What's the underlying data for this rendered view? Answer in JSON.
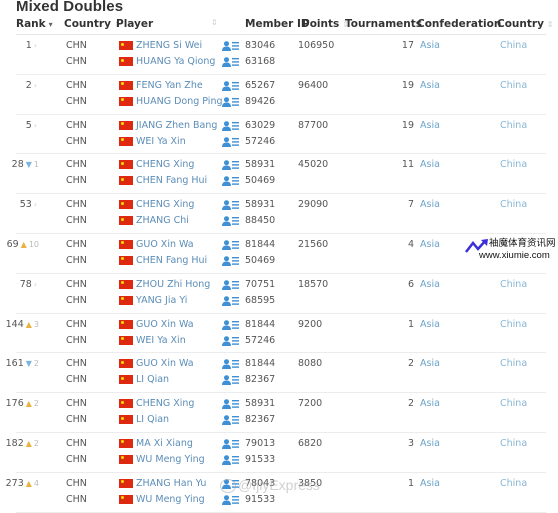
{
  "title": "Mixed Doubles",
  "columns": {
    "rank": "Rank",
    "country": "Country",
    "player": "Player",
    "member_id": "Member ID",
    "points": "Points",
    "tournaments": "Tournaments",
    "confederation": "Confederation",
    "country2": "Country"
  },
  "rows": [
    {
      "rank": "1",
      "change": {
        "dir": "same",
        "value": ""
      },
      "points": "106950",
      "tournaments": "17",
      "confederation": "Asia",
      "country": "China",
      "players": [
        {
          "country": "CHN",
          "name": "ZHENG Si Wei",
          "member_id": "83046"
        },
        {
          "country": "CHN",
          "name": "HUANG Ya Qiong",
          "member_id": "63168"
        }
      ]
    },
    {
      "rank": "2",
      "change": {
        "dir": "same",
        "value": ""
      },
      "points": "96400",
      "tournaments": "19",
      "confederation": "Asia",
      "country": "China",
      "players": [
        {
          "country": "CHN",
          "name": "FENG Yan Zhe",
          "member_id": "65267"
        },
        {
          "country": "CHN",
          "name": "HUANG Dong Ping",
          "member_id": "89426"
        }
      ]
    },
    {
      "rank": "5",
      "change": {
        "dir": "same",
        "value": ""
      },
      "points": "87700",
      "tournaments": "19",
      "confederation": "Asia",
      "country": "China",
      "players": [
        {
          "country": "CHN",
          "name": "JIANG Zhen Bang",
          "member_id": "63029"
        },
        {
          "country": "CHN",
          "name": "WEI Ya Xin",
          "member_id": "57246"
        }
      ]
    },
    {
      "rank": "28",
      "change": {
        "dir": "down",
        "value": "1"
      },
      "points": "45020",
      "tournaments": "11",
      "confederation": "Asia",
      "country": "China",
      "players": [
        {
          "country": "CHN",
          "name": "CHENG Xing",
          "member_id": "58931"
        },
        {
          "country": "CHN",
          "name": "CHEN Fang Hui",
          "member_id": "50469"
        }
      ]
    },
    {
      "rank": "53",
      "change": {
        "dir": "same",
        "value": ""
      },
      "points": "29090",
      "tournaments": "7",
      "confederation": "Asia",
      "country": "China",
      "players": [
        {
          "country": "CHN",
          "name": "CHENG Xing",
          "member_id": "58931"
        },
        {
          "country": "CHN",
          "name": "ZHANG Chi",
          "member_id": "88450"
        }
      ]
    },
    {
      "rank": "69",
      "change": {
        "dir": "up",
        "value": "10"
      },
      "points": "21560",
      "tournaments": "4",
      "confederation": "Asia",
      "country": "China",
      "players": [
        {
          "country": "CHN",
          "name": "GUO Xin Wa",
          "member_id": "81844"
        },
        {
          "country": "CHN",
          "name": "CHEN Fang Hui",
          "member_id": "50469"
        }
      ]
    },
    {
      "rank": "78",
      "change": {
        "dir": "same",
        "value": ""
      },
      "points": "18570",
      "tournaments": "6",
      "confederation": "Asia",
      "country": "China",
      "players": [
        {
          "country": "CHN",
          "name": "ZHOU Zhi Hong",
          "member_id": "70751"
        },
        {
          "country": "CHN",
          "name": "YANG Jia Yi",
          "member_id": "68595"
        }
      ]
    },
    {
      "rank": "144",
      "change": {
        "dir": "up",
        "value": "3"
      },
      "points": "9200",
      "tournaments": "1",
      "confederation": "Asia",
      "country": "China",
      "players": [
        {
          "country": "CHN",
          "name": "GUO Xin Wa",
          "member_id": "81844"
        },
        {
          "country": "CHN",
          "name": "WEI Ya Xin",
          "member_id": "57246"
        }
      ]
    },
    {
      "rank": "161",
      "change": {
        "dir": "down",
        "value": "2"
      },
      "points": "8080",
      "tournaments": "2",
      "confederation": "Asia",
      "country": "China",
      "players": [
        {
          "country": "CHN",
          "name": "GUO Xin Wa",
          "member_id": "81844"
        },
        {
          "country": "CHN",
          "name": "LI Qian",
          "member_id": "82367"
        }
      ]
    },
    {
      "rank": "176",
      "change": {
        "dir": "up",
        "value": "2"
      },
      "points": "7200",
      "tournaments": "2",
      "confederation": "Asia",
      "country": "China",
      "players": [
        {
          "country": "CHN",
          "name": "CHENG Xing",
          "member_id": "58931"
        },
        {
          "country": "CHN",
          "name": "LI Qian",
          "member_id": "82367"
        }
      ]
    },
    {
      "rank": "182",
      "change": {
        "dir": "up",
        "value": "2"
      },
      "points": "6820",
      "tournaments": "3",
      "confederation": "Asia",
      "country": "China",
      "players": [
        {
          "country": "CHN",
          "name": "MA Xi Xiang",
          "member_id": "79013"
        },
        {
          "country": "CHN",
          "name": "WU Meng Ying",
          "member_id": "91533"
        }
      ]
    },
    {
      "rank": "273",
      "change": {
        "dir": "up",
        "value": "4"
      },
      "points": "3850",
      "tournaments": "1",
      "confederation": "Asia",
      "country": "China",
      "players": [
        {
          "country": "CHN",
          "name": "ZHANG Han Yu",
          "member_id": "78043"
        },
        {
          "country": "CHN",
          "name": "WU Meng Ying",
          "member_id": "91533"
        }
      ]
    }
  ],
  "icons": {
    "sort_active": "▾",
    "sort_inactive": "⇕",
    "up": "▲",
    "down": "▼",
    "same": "›",
    "member_card": "member-profile-icon",
    "flag": "china-flag-icon"
  },
  "watermarks": {
    "site_cn": "袖魔体育资讯网",
    "site_url": "www.xiumie.com",
    "social": "@IjiyExpress"
  },
  "colors": {
    "link": "#5b8db8",
    "up": "#e8b340",
    "down": "#7bb4e0",
    "flag_red": "#de2910"
  }
}
